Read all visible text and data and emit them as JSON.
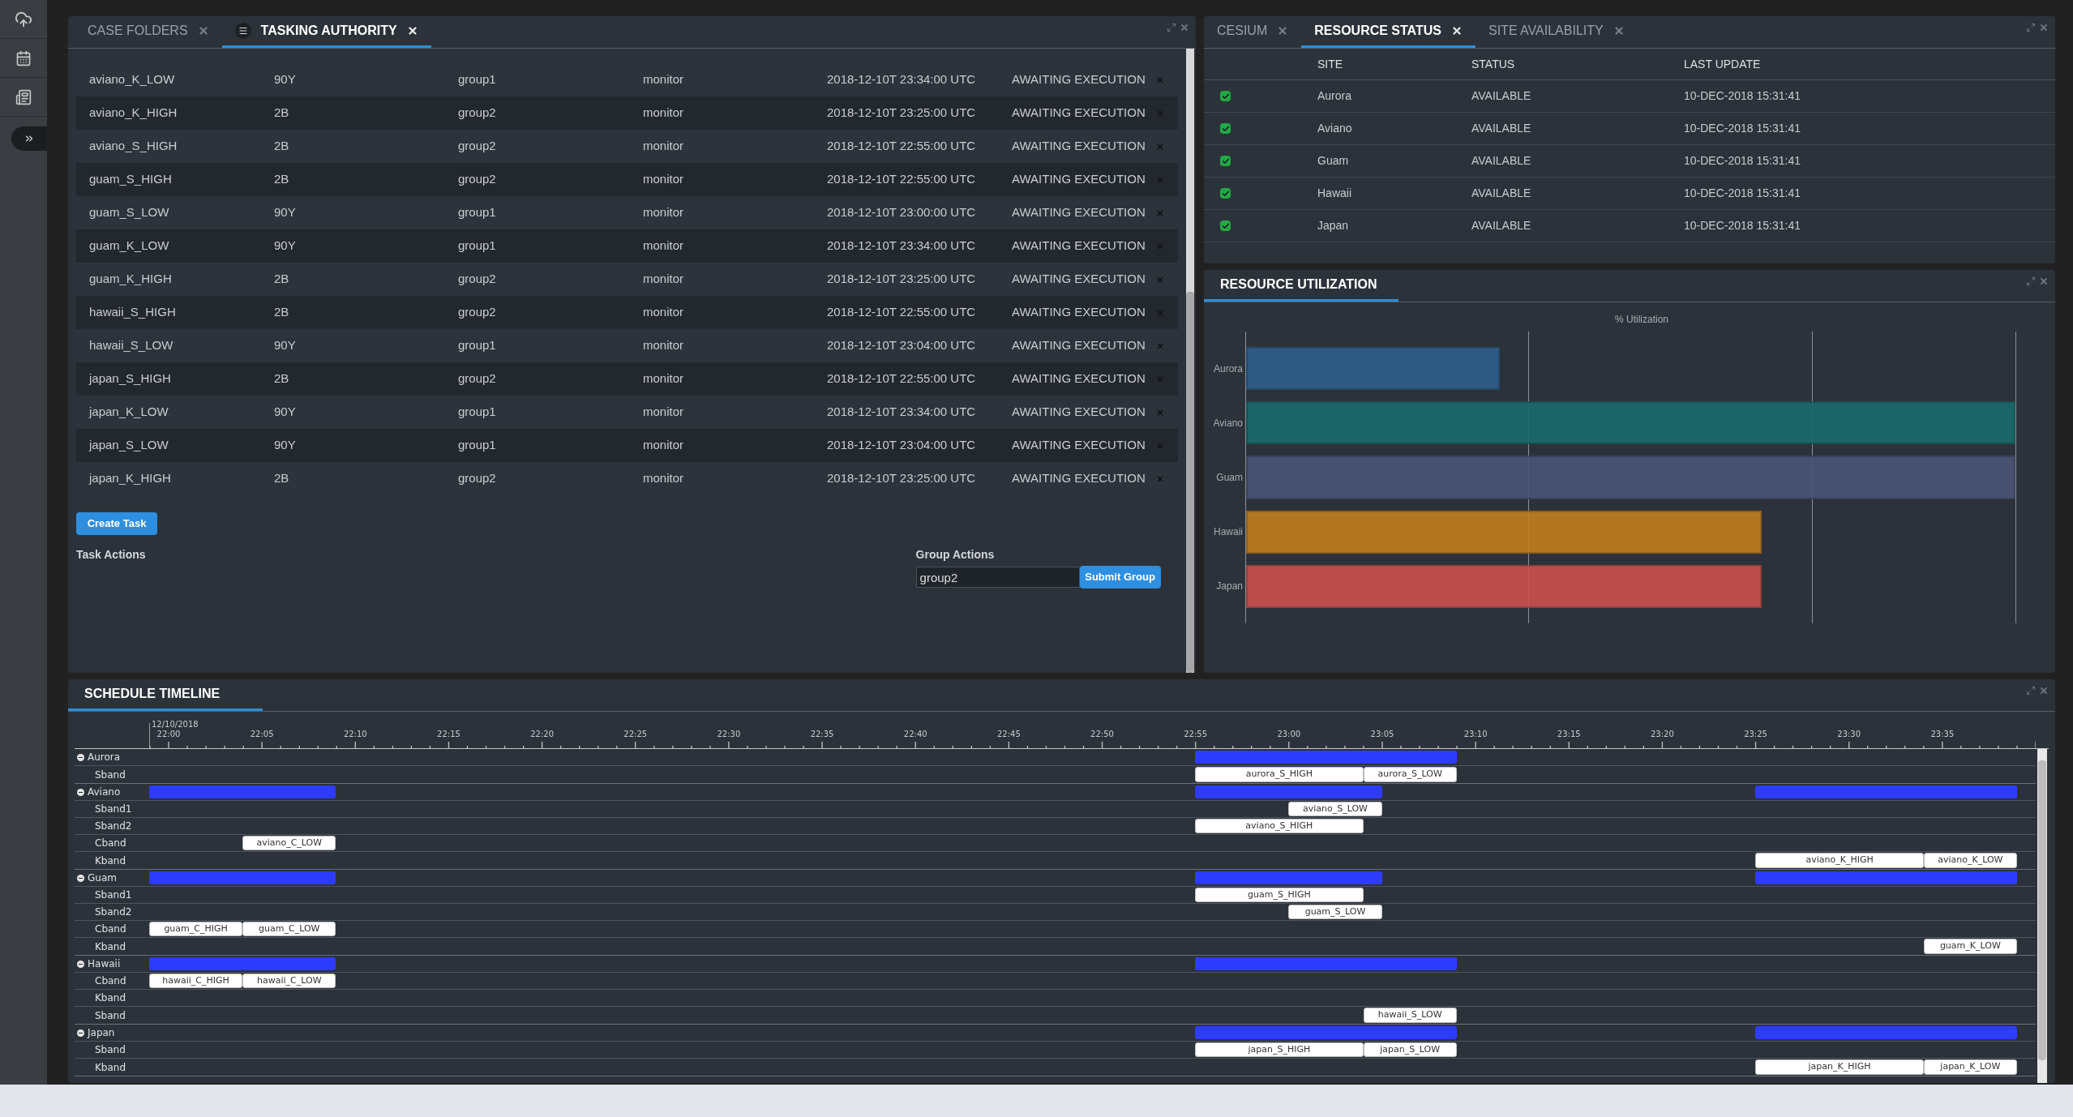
{
  "tasking_panel": {
    "tabs": [
      {
        "label": "CASE FOLDERS",
        "selected": false,
        "has_menu": false
      },
      {
        "label": "TASKING AUTHORITY",
        "selected": true,
        "has_menu": true
      }
    ],
    "rows": [
      {
        "name": "aviano_K_LOW",
        "type": "90Y",
        "group": "group1",
        "mode": "monitor",
        "time": "2018-12-10T 23:34:00 UTC",
        "status": "AWAITING EXECUTION"
      },
      {
        "name": "aviano_K_HIGH",
        "type": "2B",
        "group": "group2",
        "mode": "monitor",
        "time": "2018-12-10T 23:25:00 UTC",
        "status": "AWAITING EXECUTION"
      },
      {
        "name": "aviano_S_HIGH",
        "type": "2B",
        "group": "group2",
        "mode": "monitor",
        "time": "2018-12-10T 22:55:00 UTC",
        "status": "AWAITING EXECUTION"
      },
      {
        "name": "guam_S_HIGH",
        "type": "2B",
        "group": "group2",
        "mode": "monitor",
        "time": "2018-12-10T 22:55:00 UTC",
        "status": "AWAITING EXECUTION"
      },
      {
        "name": "guam_S_LOW",
        "type": "90Y",
        "group": "group1",
        "mode": "monitor",
        "time": "2018-12-10T 23:00:00 UTC",
        "status": "AWAITING EXECUTION"
      },
      {
        "name": "guam_K_LOW",
        "type": "90Y",
        "group": "group1",
        "mode": "monitor",
        "time": "2018-12-10T 23:34:00 UTC",
        "status": "AWAITING EXECUTION"
      },
      {
        "name": "guam_K_HIGH",
        "type": "2B",
        "group": "group2",
        "mode": "monitor",
        "time": "2018-12-10T 23:25:00 UTC",
        "status": "AWAITING EXECUTION"
      },
      {
        "name": "hawaii_S_HIGH",
        "type": "2B",
        "group": "group2",
        "mode": "monitor",
        "time": "2018-12-10T 22:55:00 UTC",
        "status": "AWAITING EXECUTION"
      },
      {
        "name": "hawaii_S_LOW",
        "type": "90Y",
        "group": "group1",
        "mode": "monitor",
        "time": "2018-12-10T 23:04:00 UTC",
        "status": "AWAITING EXECUTION"
      },
      {
        "name": "japan_S_HIGH",
        "type": "2B",
        "group": "group2",
        "mode": "monitor",
        "time": "2018-12-10T 22:55:00 UTC",
        "status": "AWAITING EXECUTION"
      },
      {
        "name": "japan_K_LOW",
        "type": "90Y",
        "group": "group1",
        "mode": "monitor",
        "time": "2018-12-10T 23:34:00 UTC",
        "status": "AWAITING EXECUTION"
      },
      {
        "name": "japan_S_LOW",
        "type": "90Y",
        "group": "group1",
        "mode": "monitor",
        "time": "2018-12-10T 23:04:00 UTC",
        "status": "AWAITING EXECUTION"
      },
      {
        "name": "japan_K_HIGH",
        "type": "2B",
        "group": "group2",
        "mode": "monitor",
        "time": "2018-12-10T 23:25:00 UTC",
        "status": "AWAITING EXECUTION"
      }
    ],
    "create_button": "Create Task",
    "task_actions_label": "Task Actions",
    "group_actions_label": "Group Actions",
    "group_input": "group2",
    "submit_button": "Submit Group"
  },
  "status_panel": {
    "tabs": [
      {
        "label": "CESIUM",
        "selected": false
      },
      {
        "label": "RESOURCE STATUS",
        "selected": true
      },
      {
        "label": "SITE AVAILABILITY",
        "selected": false
      }
    ],
    "columns": [
      "SITE",
      "STATUS",
      "LAST UPDATE"
    ],
    "rows": [
      {
        "checked": true,
        "site": "Aurora",
        "status": "AVAILABLE",
        "last_update": "10-DEC-2018 15:31:41"
      },
      {
        "checked": true,
        "site": "Aviano",
        "status": "AVAILABLE",
        "last_update": "10-DEC-2018 15:31:41"
      },
      {
        "checked": true,
        "site": "Guam",
        "status": "AVAILABLE",
        "last_update": "10-DEC-2018 15:31:41"
      },
      {
        "checked": true,
        "site": "Hawaii",
        "status": "AVAILABLE",
        "last_update": "10-DEC-2018 15:31:41"
      },
      {
        "checked": true,
        "site": "Japan",
        "status": "AVAILABLE",
        "last_update": "10-DEC-2018 15:31:41"
      }
    ]
  },
  "utilization_panel": {
    "title": "RESOURCE UTILIZATION",
    "axis_title": "% Utilization",
    "bars": [
      {
        "label": "Aurora",
        "color": "#2f5f8c",
        "level": 0.33
      },
      {
        "label": "Aviano",
        "color": "#1b6b6c",
        "level": 1.0
      },
      {
        "label": "Guam",
        "color": "#4b5475",
        "level": 1.0
      },
      {
        "label": "Hawaii",
        "color": "#c27f20",
        "level": 0.67
      },
      {
        "label": "Japan",
        "color": "#cb5050",
        "level": 0.67
      }
    ]
  },
  "timeline": {
    "title": "SCHEDULE TIMELINE",
    "date": "12/10/2018",
    "ticks": [
      "22:00",
      "22:05",
      "22:10",
      "22:15",
      "22:20",
      "22:25",
      "22:30",
      "22:35",
      "22:40",
      "22:45",
      "22:50",
      "22:55",
      "23:00",
      "23:05",
      "23:10",
      "23:15",
      "23:20",
      "23:25",
      "23:30",
      "23:35"
    ],
    "groups": [
      {
        "name": "Aurora",
        "expanded": true,
        "lanes": [
          {
            "name": "Sband",
            "tasks": [
              {
                "label": "aurora_S_HIGH"
              },
              {
                "label": "aurora_S_LOW"
              }
            ]
          }
        ]
      },
      {
        "name": "Aviano",
        "expanded": true,
        "lanes": [
          {
            "name": "Sband1",
            "tasks": [
              {
                "label": "aviano_S_LOW"
              }
            ]
          },
          {
            "name": "Sband2",
            "tasks": [
              {
                "label": "aviano_S_HIGH"
              }
            ]
          },
          {
            "name": "Cband",
            "tasks": [
              {
                "label": "aviano_C_LOW"
              }
            ]
          },
          {
            "name": "Kband",
            "tasks": [
              {
                "label": "aviano_K_HIGH"
              },
              {
                "label": "aviano_K_LOW"
              }
            ]
          }
        ]
      },
      {
        "name": "Guam",
        "expanded": true,
        "lanes": [
          {
            "name": "Sband1",
            "tasks": [
              {
                "label": "guam_S_HIGH"
              }
            ]
          },
          {
            "name": "Sband2",
            "tasks": [
              {
                "label": "guam_S_LOW"
              }
            ]
          },
          {
            "name": "Cband",
            "tasks": [
              {
                "label": "guam_C_HIGH"
              },
              {
                "label": "guam_C_LOW"
              }
            ]
          },
          {
            "name": "Kband",
            "tasks": [
              {
                "label": "guam_K_LOW"
              }
            ]
          }
        ]
      },
      {
        "name": "Hawaii",
        "expanded": true,
        "lanes": [
          {
            "name": "Cband",
            "tasks": [
              {
                "label": "hawaii_C_HIGH"
              },
              {
                "label": "hawaii_C_LOW"
              }
            ]
          },
          {
            "name": "Kband"
          },
          {
            "name": "Sband",
            "tasks": [
              {
                "label": "hawaii_S_LOW"
              }
            ]
          }
        ]
      },
      {
        "name": "Japan",
        "expanded": true,
        "lanes": [
          {
            "name": "Sband",
            "tasks": [
              {
                "label": "japan_S_HIGH"
              },
              {
                "label": "japan_S_LOW"
              }
            ]
          },
          {
            "name": "Kband",
            "tasks": [
              {
                "label": "japan_K_HIGH"
              },
              {
                "label": "japan_K_LOW"
              }
            ]
          }
        ]
      }
    ]
  }
}
